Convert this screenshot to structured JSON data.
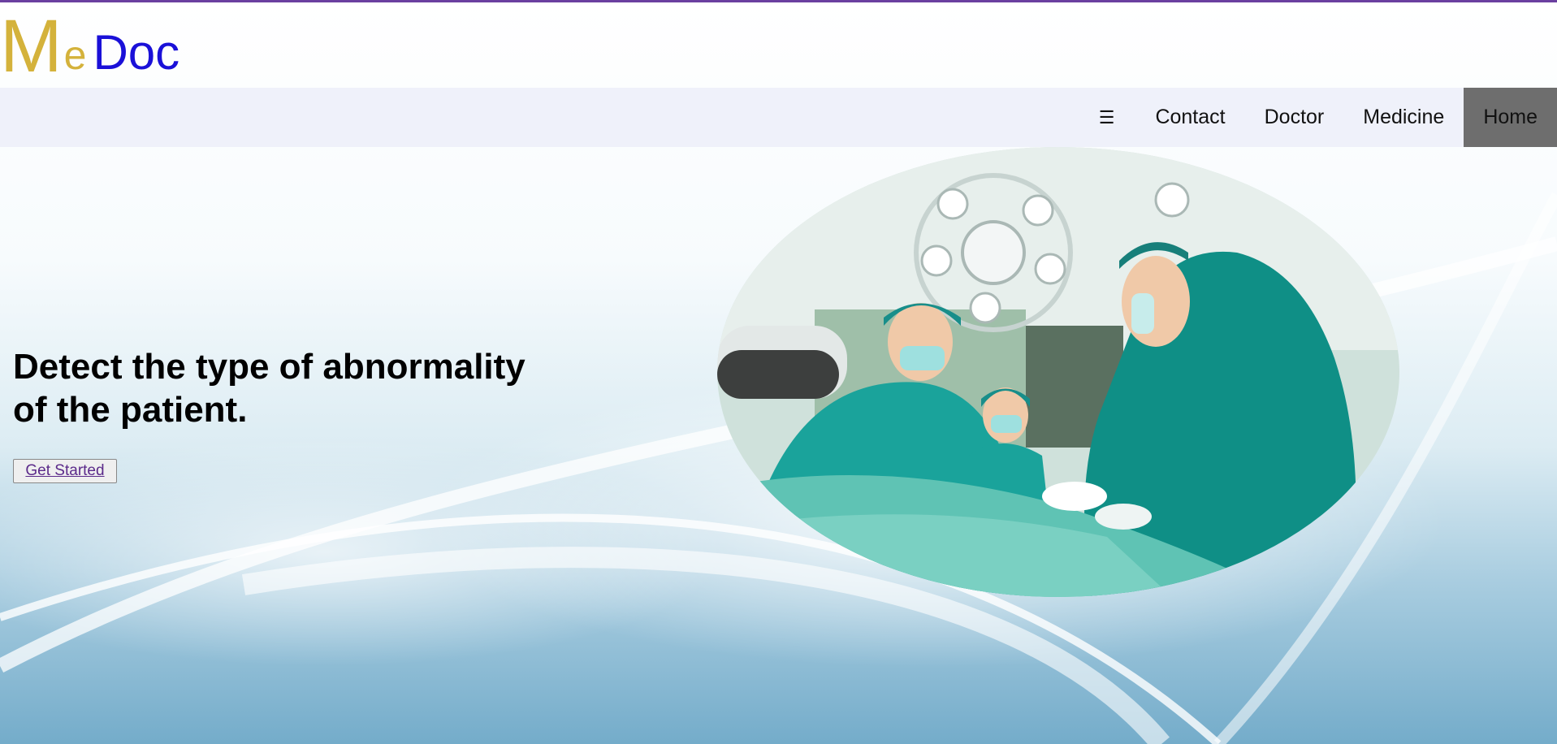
{
  "logo": {
    "m": "M",
    "e": "e",
    "doc": "Doc"
  },
  "nav": {
    "menu_icon": "☰",
    "items": [
      {
        "label": "Contact"
      },
      {
        "label": "Doctor"
      },
      {
        "label": "Medicine"
      },
      {
        "label": "Home"
      }
    ],
    "active": "Home"
  },
  "hero": {
    "title": "Detect the type of abnormality of the patient.",
    "cta_label": "Get Started"
  },
  "colors": {
    "accent_gold": "#d4b23b",
    "accent_blue": "#1a10d8",
    "top_border": "#6b3fa0",
    "nav_active_bg": "#6e6e6e",
    "link_purple": "#5b2a8a"
  },
  "icons": {
    "menu": "hamburger-menu-icon"
  }
}
